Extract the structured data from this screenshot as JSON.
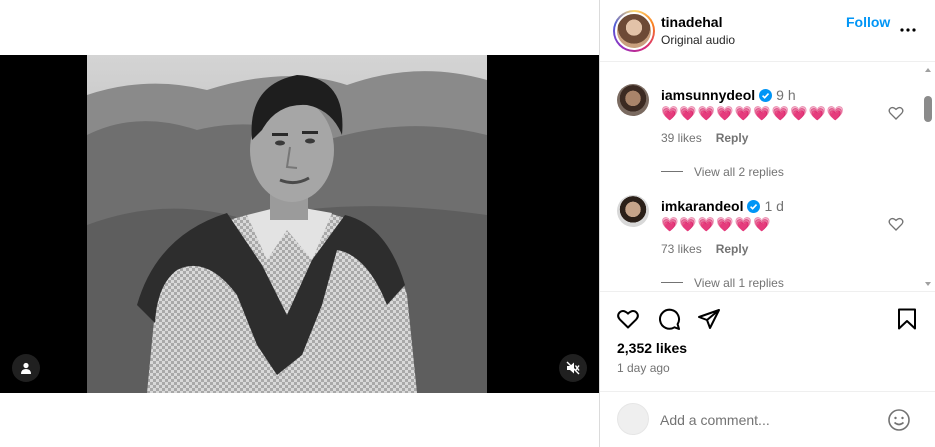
{
  "post": {
    "username": "tinadehal",
    "subtitle": "Original audio",
    "follow_label": "Follow",
    "likes": "2,352 likes",
    "time_ago": "1 day ago"
  },
  "video": {
    "user_tag_icon": "person-icon",
    "mute_icon": "speaker-muted-icon",
    "muted": true
  },
  "comments": [
    {
      "username": "iamsunnydeol",
      "verified": true,
      "time": "9 h",
      "text": "💗💗💗💗💗💗💗💗💗💗",
      "likes": "39 likes",
      "reply_label": "Reply",
      "view_replies": "View all 2 replies"
    },
    {
      "username": "imkarandeol",
      "verified": true,
      "time": "1 d",
      "text": "💗💗💗💗💗💗",
      "likes": "73 likes",
      "reply_label": "Reply",
      "view_replies": "View all 1 replies"
    }
  ],
  "composer": {
    "placeholder": "Add a comment..."
  },
  "colors": {
    "accent": "#0095f6",
    "heart": "#ed4956",
    "verified": "#0095f6",
    "secondary_text": "#737373"
  }
}
